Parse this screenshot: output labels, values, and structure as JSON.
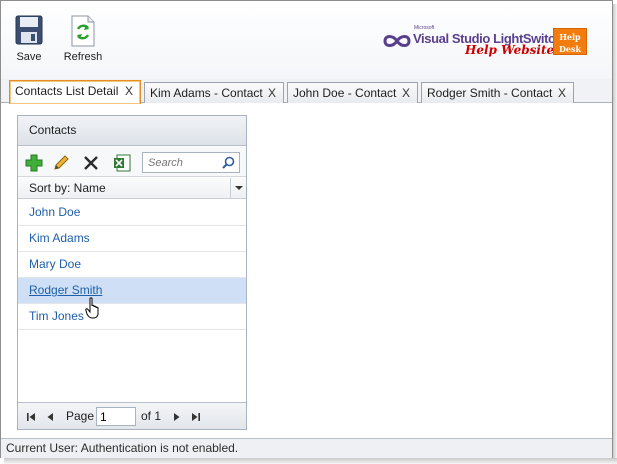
{
  "toolbar": {
    "save_label": "Save",
    "refresh_label": "Refresh"
  },
  "logo": {
    "microsoft": "Microsoft",
    "product": "Visual Studio LightSwitch",
    "tagline": "Help Website",
    "badge_line1": "Help",
    "badge_line2": "Desk"
  },
  "tabs": [
    {
      "label": "Contacts List Detail",
      "close": "X",
      "active": true
    },
    {
      "label": "Kim Adams - Contact",
      "close": "X",
      "active": false
    },
    {
      "label": "John Doe - Contact",
      "close": "X",
      "active": false
    },
    {
      "label": "Rodger Smith - Contact",
      "close": "X",
      "active": false
    }
  ],
  "panel": {
    "title": "Contacts",
    "search_placeholder": "Search",
    "sort_label": "Sort by: Name",
    "items": [
      "John Doe",
      "Kim Adams",
      "Mary Doe",
      "Rodger Smith",
      "Tim Jones"
    ],
    "selected_index": 3,
    "pager": {
      "page_label": "Page",
      "page_value": "1",
      "of_label": "of 1"
    }
  },
  "icons": {
    "save": "floppy-disk-icon",
    "refresh": "refresh-icon",
    "add": "plus-icon",
    "edit": "pencil-icon",
    "delete": "x-icon",
    "export": "excel-icon",
    "search": "magnifier-icon"
  },
  "colors": {
    "link": "#1e5fa8",
    "selected_row": "#cfe0f6",
    "active_tab_border": "#e58e26",
    "logo_purple": "#5a3f8d",
    "logo_red": "#cc0000",
    "badge_orange": "#f27d0c"
  },
  "status": {
    "text": "Current User: Authentication is not enabled."
  }
}
